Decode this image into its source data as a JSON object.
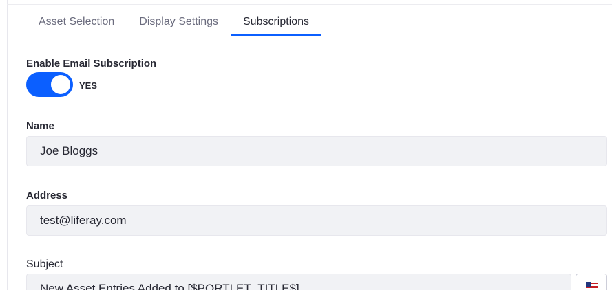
{
  "tabs": [
    {
      "label": "Asset Selection",
      "active": false
    },
    {
      "label": "Display Settings",
      "active": false
    },
    {
      "label": "Subscriptions",
      "active": true
    }
  ],
  "email_subscription": {
    "label": "Enable Email Subscription",
    "enabled": true,
    "state_label": "YES"
  },
  "name_field": {
    "label": "Name",
    "value": "Joe Bloggs"
  },
  "address_field": {
    "label": "Address",
    "value": "test@liferay.com"
  },
  "subject_field": {
    "label": "Subject",
    "value": "New Asset Entries Added to [$PORTLET_TITLE$]",
    "language_icon": "us-flag-icon"
  },
  "colors": {
    "accent": "#0b5fff",
    "input_background": "#f1f2f5",
    "text": "#272833",
    "muted_text": "#6b6c7e"
  }
}
